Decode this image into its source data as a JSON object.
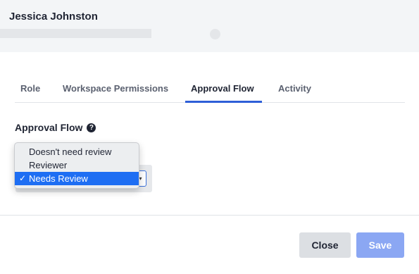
{
  "header": {
    "user_name": "Jessica Johnston"
  },
  "tabs": [
    {
      "label": "Role",
      "active": false
    },
    {
      "label": "Workspace Permissions",
      "active": false
    },
    {
      "label": "Approval Flow",
      "active": true
    },
    {
      "label": "Activity",
      "active": false
    }
  ],
  "approval_flow": {
    "title": "Approval Flow",
    "help_icon": "question-circle-icon",
    "options": [
      "Doesn't need review",
      "Reviewer",
      "Needs Review"
    ],
    "selected": "Needs Review",
    "check_glyph": "✓"
  },
  "footer": {
    "close_label": "Close",
    "save_label": "Save"
  },
  "colors": {
    "accent": "#2e5fd8",
    "selected_option": "#1e6ef3",
    "save_disabled": "#8ba7f3"
  }
}
